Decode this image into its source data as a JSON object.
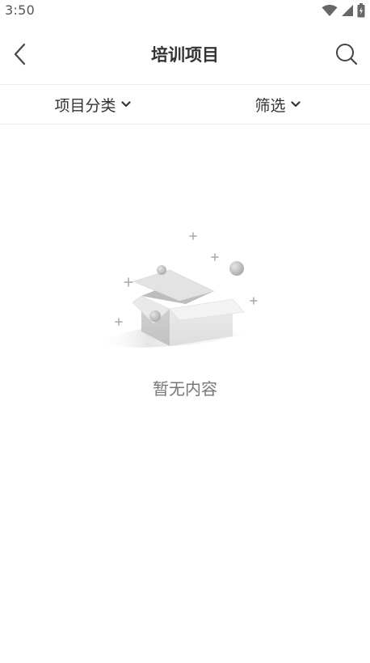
{
  "status_bar": {
    "time": "3:50",
    "icons": [
      "wifi-icon",
      "cell-signal-icon",
      "battery-icon"
    ]
  },
  "header": {
    "title": "培训项目",
    "back_icon": "chevron-left-icon",
    "search_icon": "search-icon"
  },
  "filters": {
    "category_label": "项目分类",
    "filter_label": "筛选",
    "dropdown_icon": "chevron-down-icon"
  },
  "empty_state": {
    "illustration": "empty-box-icon",
    "message": "暂无内容"
  },
  "colors": {
    "background": "#ffffff",
    "title_text": "#333333",
    "muted_text": "#777777",
    "divider": "#ececec"
  }
}
